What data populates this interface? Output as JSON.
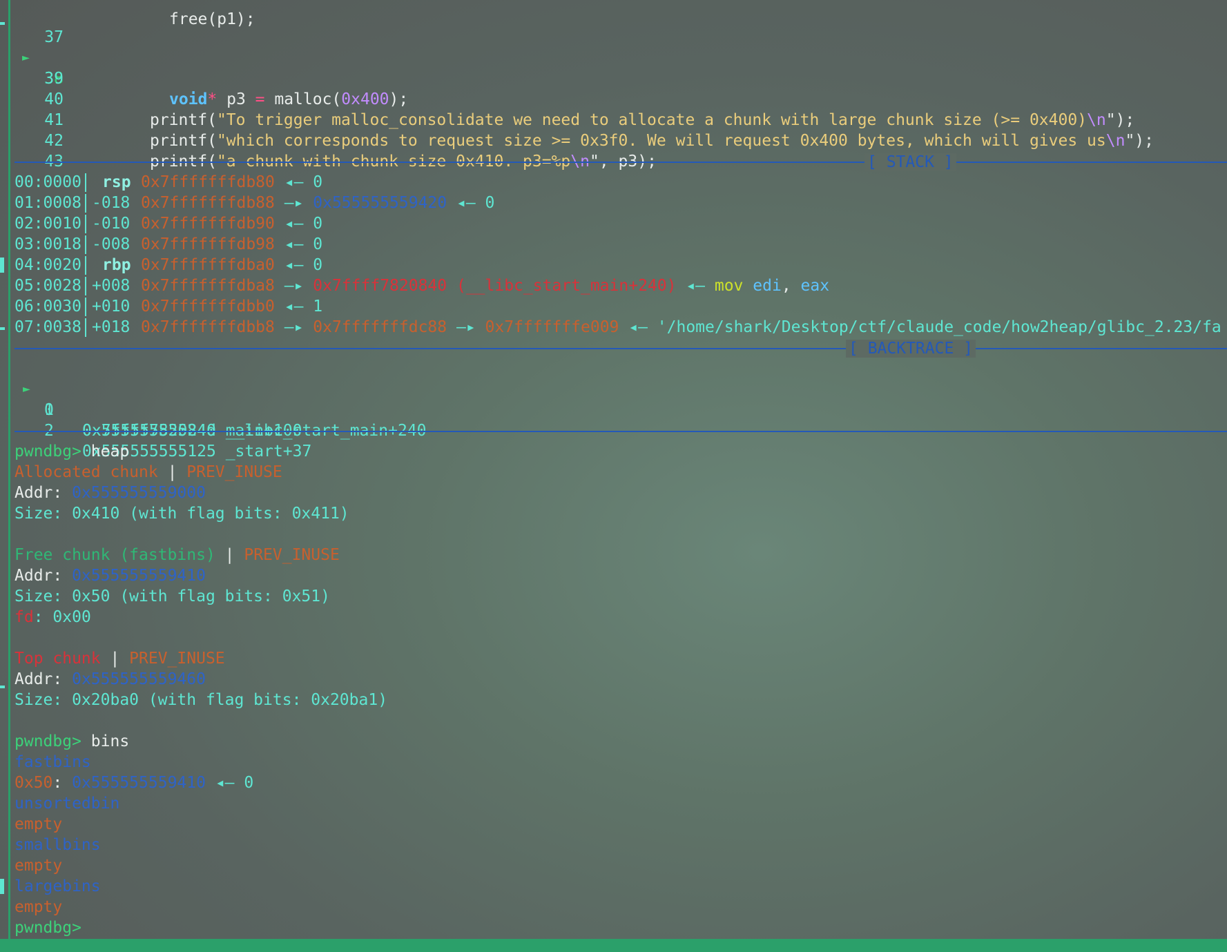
{
  "source": {
    "partial_top_text": "free(p1);",
    "lines": [
      {
        "num": "37",
        "current": false,
        "text": ""
      },
      {
        "num": "38",
        "current": true,
        "type": "void",
        "ptr": "*",
        "var": " p3 ",
        "eq": "=",
        "call": " malloc(",
        "arg": "0x400",
        "end": ");"
      },
      {
        "num": "39",
        "current": false,
        "text": ""
      },
      {
        "num": "40",
        "current": false,
        "fn": "printf(",
        "str": "\"To trigger malloc_consolidate we need to allocate a chunk with large chunk size (>= 0x400)",
        "esc": "\\n",
        "close": "\");"
      },
      {
        "num": "41",
        "current": false,
        "fn": "printf(",
        "str": "\"which corresponds to request size >= 0x3f0. We will request 0x400 bytes, which will gives us",
        "esc": "\\n",
        "close": "\");"
      },
      {
        "num": "42",
        "current": false,
        "fn": "printf(",
        "str": "\"a chunk with chunk size 0x410. p3=%p",
        "esc": "\\n",
        "close": "\", p3);"
      },
      {
        "num": "43",
        "current": false,
        "text": ""
      }
    ]
  },
  "stack": {
    "title": "[ STACK ]",
    "rows": [
      {
        "idx": "00:0000",
        "reg": "rsp",
        "addr": "0x7fffffffdb80",
        "rest": [
          {
            "t": " ◂— ",
            "c": "cyan"
          },
          {
            "t": "0",
            "c": "cyan"
          }
        ]
      },
      {
        "idx": "01:0008",
        "reg": "-018",
        "addr": "0x7fffffffdb88",
        "rest": [
          {
            "t": " —▸ ",
            "c": "cyan"
          },
          {
            "t": "0x555555559420",
            "c": "blu"
          },
          {
            "t": " ◂— ",
            "c": "cyan"
          },
          {
            "t": "0",
            "c": "cyan"
          }
        ]
      },
      {
        "idx": "02:0010",
        "reg": "-010",
        "addr": "0x7fffffffdb90",
        "rest": [
          {
            "t": " ◂— ",
            "c": "cyan"
          },
          {
            "t": "0",
            "c": "cyan"
          }
        ]
      },
      {
        "idx": "03:0018",
        "reg": "-008",
        "addr": "0x7fffffffdb98",
        "rest": [
          {
            "t": " ◂— ",
            "c": "cyan"
          },
          {
            "t": "0",
            "c": "cyan"
          }
        ]
      },
      {
        "idx": "04:0020",
        "reg": "rbp",
        "addr": "0x7fffffffdba0",
        "rest": [
          {
            "t": " ◂— ",
            "c": "cyan"
          },
          {
            "t": "0",
            "c": "cyan"
          }
        ]
      },
      {
        "idx": "05:0028",
        "reg": "+008",
        "addr": "0x7fffffffdba8",
        "rest": [
          {
            "t": " —▸ ",
            "c": "cyan"
          },
          {
            "t": "0x7ffff7820840 (__libc_start_main+240)",
            "c": "red"
          },
          {
            "t": " ◂— ",
            "c": "cyan"
          },
          {
            "t": "mov",
            "c": "ins"
          },
          {
            "t": " ",
            "c": "cyan"
          },
          {
            "t": "edi",
            "c": "regc"
          },
          {
            "t": ", ",
            "c": "wht"
          },
          {
            "t": "eax",
            "c": "regc"
          }
        ]
      },
      {
        "idx": "06:0030",
        "reg": "+010",
        "addr": "0x7fffffffdbb0",
        "rest": [
          {
            "t": " ◂— ",
            "c": "cyan"
          },
          {
            "t": "1",
            "c": "cyan"
          }
        ]
      },
      {
        "idx": "07:0038",
        "reg": "+018",
        "addr": "0x7fffffffdbb8",
        "rest": [
          {
            "t": " —▸ ",
            "c": "cyan"
          },
          {
            "t": "0x7fffffffdc88",
            "c": "ocol"
          },
          {
            "t": " —▸ ",
            "c": "cyan"
          },
          {
            "t": "0x7fffffffe009",
            "c": "ocol"
          },
          {
            "t": " ◂— ",
            "c": "cyan"
          },
          {
            "t": "'/home/shark/Desktop/ctf/claude_code/how2heap/glibc_2.23/fa",
            "c": "cyan"
          }
        ]
      }
    ]
  },
  "backtrace": {
    "title": "[ BACKTRACE ]",
    "frames": [
      {
        "n": "0",
        "current": true,
        "text": "0x55555555524d main+100"
      },
      {
        "n": "1",
        "current": false,
        "text": "0x7ffff7820840 __libc_start_main+240"
      },
      {
        "n": "2",
        "current": false,
        "text": "0x555555555125 _start+37"
      }
    ]
  },
  "terminal": [
    [
      {
        "t": "pwndbg> ",
        "c": "prompt"
      },
      {
        "t": "heap",
        "c": "wht"
      }
    ],
    [
      {
        "t": "Allocated chunk",
        "c": "ocol"
      },
      {
        "t": " | ",
        "c": "wht"
      },
      {
        "t": "PREV_INUSE",
        "c": "ocol"
      }
    ],
    [
      {
        "t": "Addr: ",
        "c": "wht"
      },
      {
        "t": "0x555555559000",
        "c": "blu"
      }
    ],
    [
      {
        "t": "Size: 0x410 (with flag bits: 0x411)",
        "c": "cyan"
      }
    ],
    [],
    [
      {
        "t": "Free chunk (fastbins)",
        "c": "grn"
      },
      {
        "t": " | ",
        "c": "wht"
      },
      {
        "t": "PREV_INUSE",
        "c": "ocol"
      }
    ],
    [
      {
        "t": "Addr: ",
        "c": "wht"
      },
      {
        "t": "0x555555559410",
        "c": "blu"
      }
    ],
    [
      {
        "t": "Size: 0x50 (with flag bits: 0x51)",
        "c": "cyan"
      }
    ],
    [
      {
        "t": "fd",
        "c": "red"
      },
      {
        "t": ": 0x00",
        "c": "cyan"
      }
    ],
    [],
    [
      {
        "t": "Top chunk",
        "c": "red"
      },
      {
        "t": " | ",
        "c": "wht"
      },
      {
        "t": "PREV_INUSE",
        "c": "ocol"
      }
    ],
    [
      {
        "t": "Addr: ",
        "c": "wht"
      },
      {
        "t": "0x555555559460",
        "c": "blu"
      }
    ],
    [
      {
        "t": "Size: 0x20ba0 (with flag bits: 0x20ba1)",
        "c": "cyan"
      }
    ],
    [],
    [
      {
        "t": "pwndbg> ",
        "c": "prompt"
      },
      {
        "t": "bins",
        "c": "wht"
      }
    ],
    [
      {
        "t": "fastbins",
        "c": "blu"
      }
    ],
    [
      {
        "t": "0x50",
        "c": "ocol"
      },
      {
        "t": ": ",
        "c": "wht"
      },
      {
        "t": "0x555555559410",
        "c": "blu"
      },
      {
        "t": " ◂— 0",
        "c": "cyan"
      }
    ],
    [
      {
        "t": "unsortedbin",
        "c": "blu"
      }
    ],
    [
      {
        "t": "empty",
        "c": "ocol"
      }
    ],
    [
      {
        "t": "smallbins",
        "c": "blu"
      }
    ],
    [
      {
        "t": "empty",
        "c": "ocol"
      }
    ],
    [
      {
        "t": "largebins",
        "c": "blu"
      }
    ],
    [
      {
        "t": "empty",
        "c": "ocol"
      }
    ],
    [
      {
        "t": "pwndbg>",
        "c": "prompt"
      }
    ]
  ]
}
